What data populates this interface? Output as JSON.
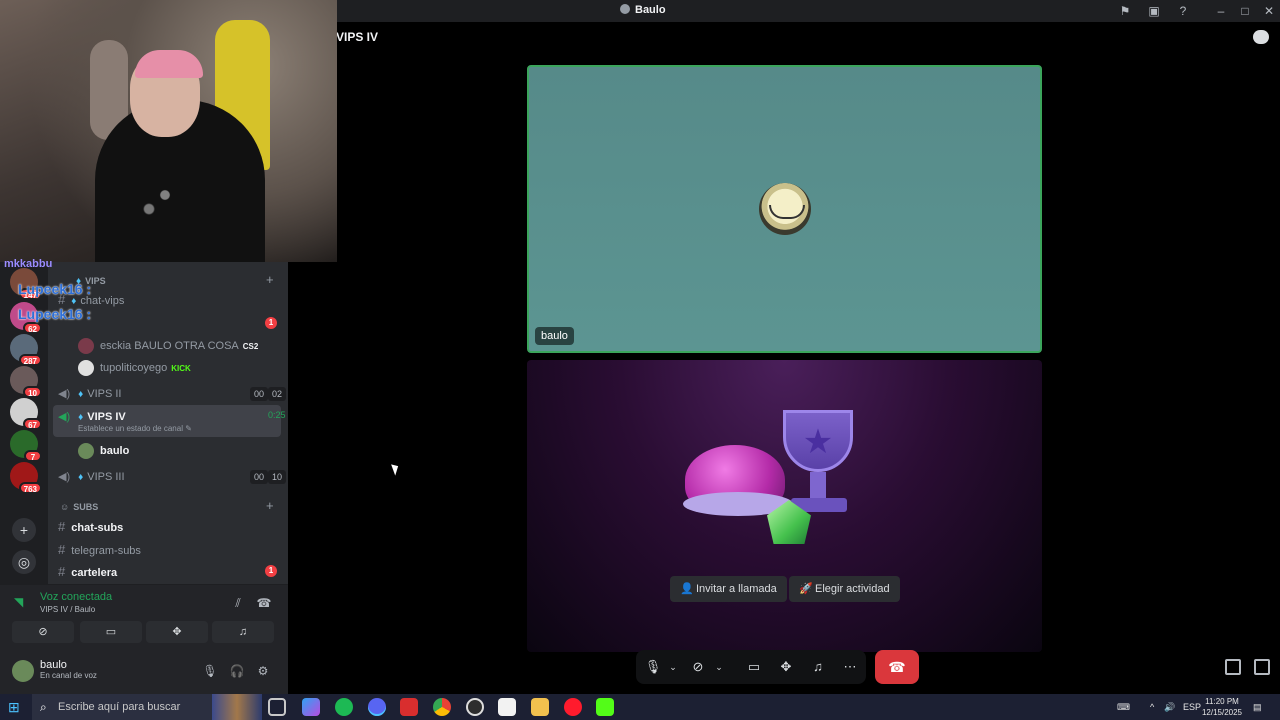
{
  "window": {
    "title": "Baulo",
    "channel_title": "VIPS IV"
  },
  "call": {
    "participant_name": "baulo",
    "invite_label": "Invitar a llamada",
    "activity_label": "Elegir actividad"
  },
  "overlay": {
    "chat_top": "mkkabbu",
    "chat_lines": [
      "Lupeek16 :",
      "Lupeek16 :"
    ]
  },
  "servers": [
    {
      "badge": "147"
    },
    {
      "badge": "62"
    },
    {
      "badge": "287"
    },
    {
      "badge": "10"
    },
    {
      "badge": "67"
    },
    {
      "badge": "7"
    },
    {
      "badge": "763"
    }
  ],
  "sidebar": {
    "category_vips": "VIPS",
    "chat_vips": "chat-vips",
    "unread_vips": "1",
    "voice_users_top": [
      {
        "name": "esckia BAULO OTRA COSA",
        "tag": "CS2"
      },
      {
        "name": "tupoliticoyego",
        "tag": "KICK"
      }
    ],
    "vips_ii": {
      "name": "VIPS II",
      "left": "00",
      "right": "02"
    },
    "vips_iv": {
      "name": "VIPS IV",
      "time": "0:25",
      "status": "Establece un estado de canal"
    },
    "vips_iv_user": "baulo",
    "vips_iii": {
      "name": "VIPS III",
      "left": "00",
      "right": "10"
    },
    "category_subs": "SUBS",
    "chat_subs": "chat-subs",
    "telegram_subs": "telegram-subs",
    "cartelera": "cartelera",
    "unread_cartelera": "1"
  },
  "voice_panel": {
    "status": "Voz conectada",
    "location": "VIPS IV / Baulo"
  },
  "user_panel": {
    "name": "baulo",
    "status": "En canal de voz"
  },
  "taskbar": {
    "search_placeholder": "Escribe aquí para buscar",
    "lang": "ESP",
    "time": "11:20 PM",
    "date": "12/15/2025"
  },
  "colors": {
    "speaking_border": "#3ba55c",
    "hangup": "#da373c",
    "connected": "#23a55a"
  }
}
